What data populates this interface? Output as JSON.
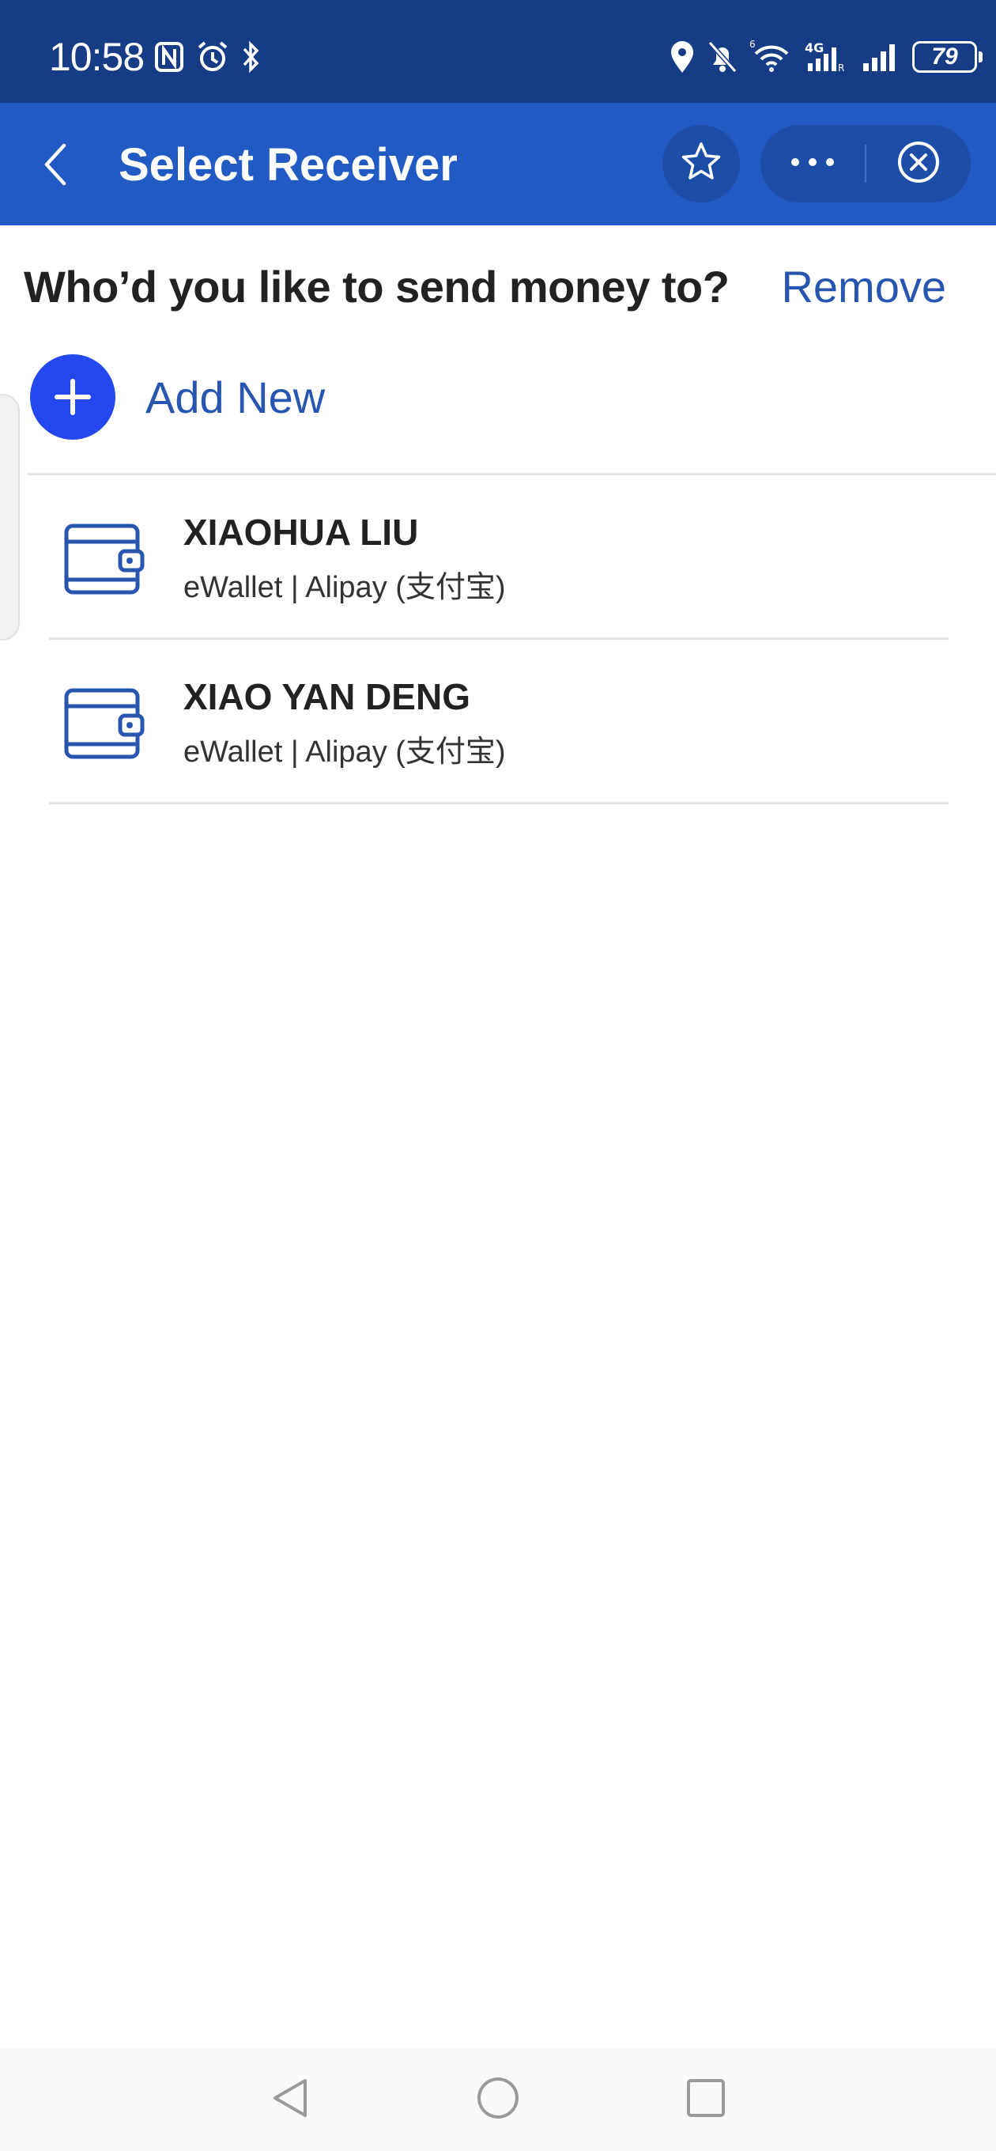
{
  "status_bar": {
    "time": "10:58",
    "battery": "79",
    "icons_left": [
      "nfc-icon",
      "alarm-icon",
      "bluetooth-icon"
    ],
    "icons_right": [
      "location-icon",
      "bell-off-icon",
      "wifi-icon",
      "mobile-data-icon",
      "signal-icon",
      "battery-icon"
    ]
  },
  "app_bar": {
    "title": "Select Receiver",
    "back_icon": "chevron-left-icon",
    "favorite_icon": "star-icon",
    "more_icon": "more-dots-icon",
    "close_icon": "close-circle-icon"
  },
  "main": {
    "question": "Who’d you like to send money to?",
    "remove_label": "Remove",
    "add_new_label": "Add New"
  },
  "receivers": [
    {
      "name": "XIAOHUA LIU",
      "detail": "eWallet | Alipay (支付宝)",
      "icon": "wallet-icon"
    },
    {
      "name": "XIAO YAN DENG",
      "detail": "eWallet | Alipay (支付宝)",
      "icon": "wallet-icon"
    }
  ],
  "colors": {
    "status_bar": "#163c86",
    "app_bar": "#225ac3",
    "accent": "#2756b0",
    "add_button": "#2349ee"
  }
}
